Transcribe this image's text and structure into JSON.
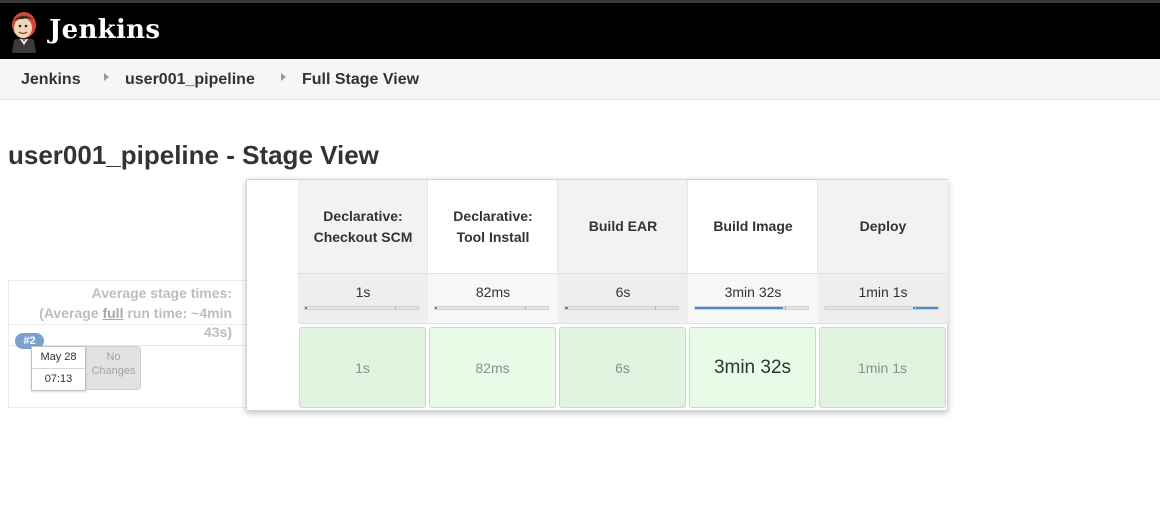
{
  "header": {
    "brand": "Jenkins",
    "logo_icon": "jenkins-butler-icon",
    "background": "#000000"
  },
  "breadcrumb": [
    {
      "label": "Jenkins"
    },
    {
      "label": "user001_pipeline"
    },
    {
      "label": "Full Stage View"
    }
  ],
  "page_title": "user001_pipeline - Stage View",
  "average": {
    "line1": "Average stage times:",
    "line2_prefix": "(Average ",
    "line2_link": "full",
    "line2_suffix": " run time: ~4min",
    "line3": "43s)"
  },
  "run": {
    "badge": "#2",
    "date": "May 28",
    "time": "07:13",
    "changes_line1": "No",
    "changes_line2": "Changes"
  },
  "stages": [
    {
      "name": "Declarative: Checkout SCM",
      "avg": "1s",
      "avg_progress_pct": 1,
      "cell_value": "1s",
      "cell_color": "#dff3df"
    },
    {
      "name": "Declarative: Tool Install",
      "avg": "82ms",
      "avg_progress_pct": 1,
      "cell_value": "82ms",
      "cell_color": "#e7fbe7"
    },
    {
      "name": "Build EAR",
      "avg": "6s",
      "avg_progress_pct": 3,
      "cell_value": "6s",
      "cell_color": "#dff3df"
    },
    {
      "name": "Build Image",
      "avg": "3min 32s",
      "avg_progress_pct": 78,
      "cell_value": "3min 32s",
      "cell_color": "#e7fbe7"
    },
    {
      "name": "Deploy",
      "avg": "1min 1s",
      "avg_progress_pct": 22,
      "cell_value": "1min 1s",
      "cell_color": "#dff3df"
    }
  ],
  "colors": {
    "progress": "#4d88d3",
    "badge": "#7d9fce",
    "success_cell_border": "#c5dcc5"
  }
}
